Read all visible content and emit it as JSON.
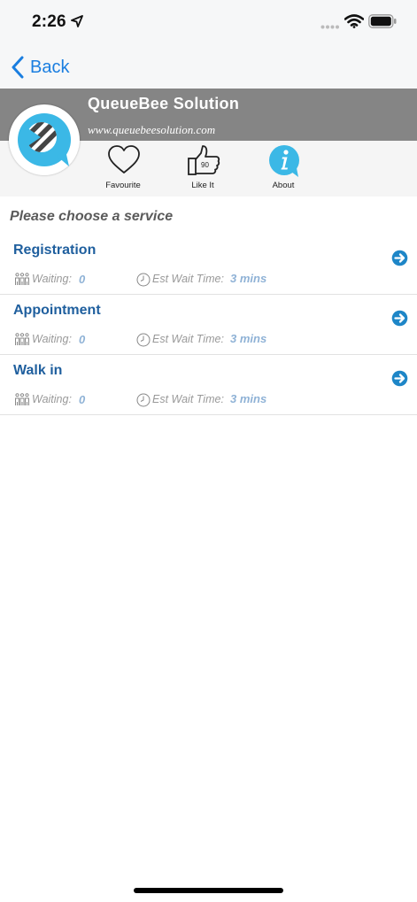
{
  "status": {
    "time": "2:26"
  },
  "nav": {
    "back_label": "Back"
  },
  "header": {
    "company_name": "QueueBee Solution",
    "company_url": "www.queuebeesolution.com"
  },
  "actions": {
    "favourite_label": "Favourite",
    "like_label": "Like It",
    "like_count": "90",
    "about_label": "About"
  },
  "main": {
    "section_title": "Please choose a service",
    "waiting_label": "Waiting:",
    "est_label": "Est Wait Time:",
    "services": [
      {
        "name": "Registration",
        "waiting": "0",
        "est_time": "3 mins"
      },
      {
        "name": "Appointment",
        "waiting": "0",
        "est_time": "3 mins"
      },
      {
        "name": "Walk in",
        "waiting": "0",
        "est_time": "3 mins"
      }
    ]
  },
  "colors": {
    "accent_blue": "#1a7ee0",
    "service_title": "#1f5f9e",
    "header_gray": "#858585",
    "logo_cyan": "#3bb8e6",
    "arrow_blue": "#1e86c7"
  },
  "icons": {
    "location": "location-arrow-icon",
    "wifi": "wifi-icon",
    "battery": "battery-icon",
    "back": "chevron-left-icon",
    "favourite": "heart-icon",
    "like": "thumbs-up-icon",
    "about": "info-icon",
    "service_arrow": "arrow-right-circle-icon",
    "waiting": "people-icon",
    "est_time": "clock-icon"
  }
}
